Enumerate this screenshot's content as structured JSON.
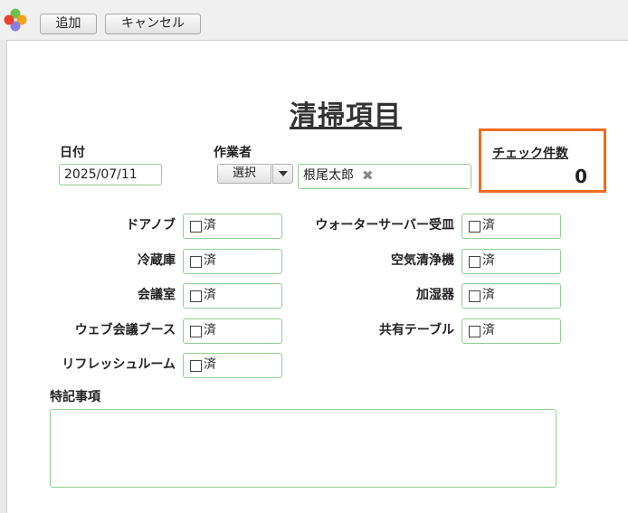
{
  "toolbar": {
    "add_label": "追加",
    "cancel_label": "キャンセル"
  },
  "logo": {
    "colors": [
      "#6cc04a",
      "#e8412c",
      "#f2a31b",
      "#8a7fe0"
    ]
  },
  "form": {
    "title": "清掃項目",
    "date": {
      "label": "日付",
      "value": "2025/07/11"
    },
    "worker": {
      "label": "作業者",
      "select_label": "選択",
      "selected_user": "根尾太郎",
      "remove_glyph": "✖"
    },
    "check_count": {
      "label": "チェック件数",
      "value": "0"
    },
    "checkbox_text": "済",
    "items_left": [
      {
        "label": "ドアノブ"
      },
      {
        "label": "冷蔵庫"
      },
      {
        "label": "会議室"
      },
      {
        "label": "ウェブ会議ブース"
      },
      {
        "label": "リフレッシュルーム"
      }
    ],
    "items_right": [
      {
        "label": "ウォーターサーバー受皿"
      },
      {
        "label": "空気清浄機"
      },
      {
        "label": "加湿器"
      },
      {
        "label": "共有テーブル"
      }
    ],
    "notes": {
      "label": "特記事項",
      "value": ""
    }
  },
  "colors": {
    "field_border": "#8fcf8f",
    "highlight_border": "#ee6d1f"
  }
}
